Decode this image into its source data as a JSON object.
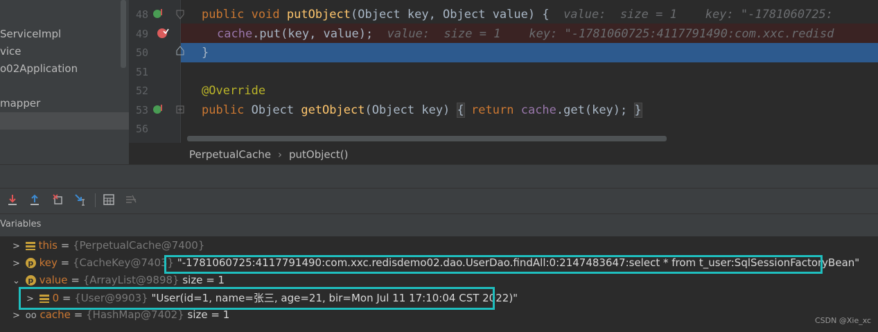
{
  "project_tree": {
    "items": [
      "ServiceImpl",
      "vice",
      "o02Application",
      "mapper"
    ]
  },
  "editor": {
    "lines": [
      {
        "num": "48",
        "code": {
          "kw1": "public",
          "kw2": "void",
          "fn": "putObject",
          "params": "(Object key, Object value) {",
          "hint": "value:  size = 1    key: \"-1781060725:"
        }
      },
      {
        "num": "49",
        "code": {
          "fld": "cache",
          "rest": ".put(key, value);",
          "hint": "value:  size = 1    key: \"-1781060725:4117791490:com.xxc.redisd"
        }
      },
      {
        "num": "50",
        "code": {
          "rest": "}"
        }
      },
      {
        "num": "51"
      },
      {
        "num": "52",
        "code": {
          "ann": "@Override"
        }
      },
      {
        "num": "53",
        "code": {
          "kw1": "public",
          "ty": "Object",
          "fn": "getObject",
          "params": "(Object key)",
          "kw2": "return",
          "fld": "cache",
          "rest": ".get(key);"
        }
      },
      {
        "num": "56"
      }
    ]
  },
  "breadcrumbs": [
    "PerpetualCache",
    "putObject()"
  ],
  "toolbar": {
    "icons": [
      "step-into-icon",
      "step-out-icon",
      "drop-frame-icon",
      "run-to-cursor-icon",
      "evaluate-icon",
      "trace-icon"
    ]
  },
  "variables": {
    "title": "Variables",
    "rows": [
      {
        "name": "this",
        "ref": "{PerpetualCache@7400}",
        "extra": ""
      },
      {
        "name": "key",
        "ref": "{CacheKey@7403}",
        "extra": "\"-1781060725:4117791490:com.xxc.redisdemo02.dao.UserDao.findAll:0:2147483647:select * from t_user:SqlSessionFactoryBean\""
      },
      {
        "name": "value",
        "ref": "{ArrayList@9898}",
        "extra": "size = 1"
      },
      {
        "name": "0",
        "ref": "{User@9903}",
        "extra": "\"User(id=1, name=张三, age=21, bir=Mon Jul 11 17:10:04 CST 2022)\""
      },
      {
        "name": "cache",
        "ref": "{HashMap@7402}",
        "extra": "size = 1"
      }
    ]
  },
  "watermark": "CSDN @Xie_xc"
}
